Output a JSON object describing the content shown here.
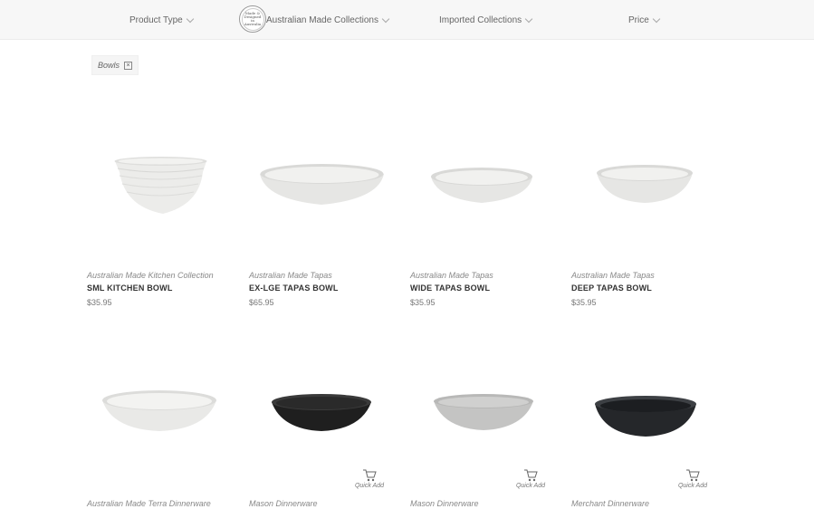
{
  "filters": {
    "product_type": "Product Type",
    "australian_made": "Australian Made Collections",
    "imported": "Imported Collections",
    "price": "Price"
  },
  "badge": {
    "line1": "Made &",
    "line2": "Designed",
    "line3": "in Australia"
  },
  "active_tag": {
    "label": "Bowls",
    "close_icon": "close-icon"
  },
  "quick_add_label": "Quick Add",
  "products": [
    {
      "collection": "Australian Made Kitchen Collection",
      "name": "SML KITCHEN BOWL",
      "price": "$35.95",
      "color": "#e8e8e6"
    },
    {
      "collection": "Australian Made Tapas",
      "name": "EX-LGE TAPAS BOWL",
      "price": "$65.95",
      "color": "#ebebea"
    },
    {
      "collection": "Australian Made Tapas",
      "name": "WIDE TAPAS BOWL",
      "price": "$35.95",
      "color": "#ebebea"
    },
    {
      "collection": "Australian Made Tapas",
      "name": "DEEP TAPAS BOWL",
      "price": "$35.95",
      "color": "#ebebea"
    },
    {
      "collection": "Australian Made Terra Dinnerware",
      "color": "#eeeeec"
    },
    {
      "collection": "Mason Dinnerware",
      "color": "#2b2b2b"
    },
    {
      "collection": "Mason Dinnerware",
      "color": "#c9c9c8"
    },
    {
      "collection": "Merchant Dinnerware",
      "color": "#2e3033"
    }
  ]
}
